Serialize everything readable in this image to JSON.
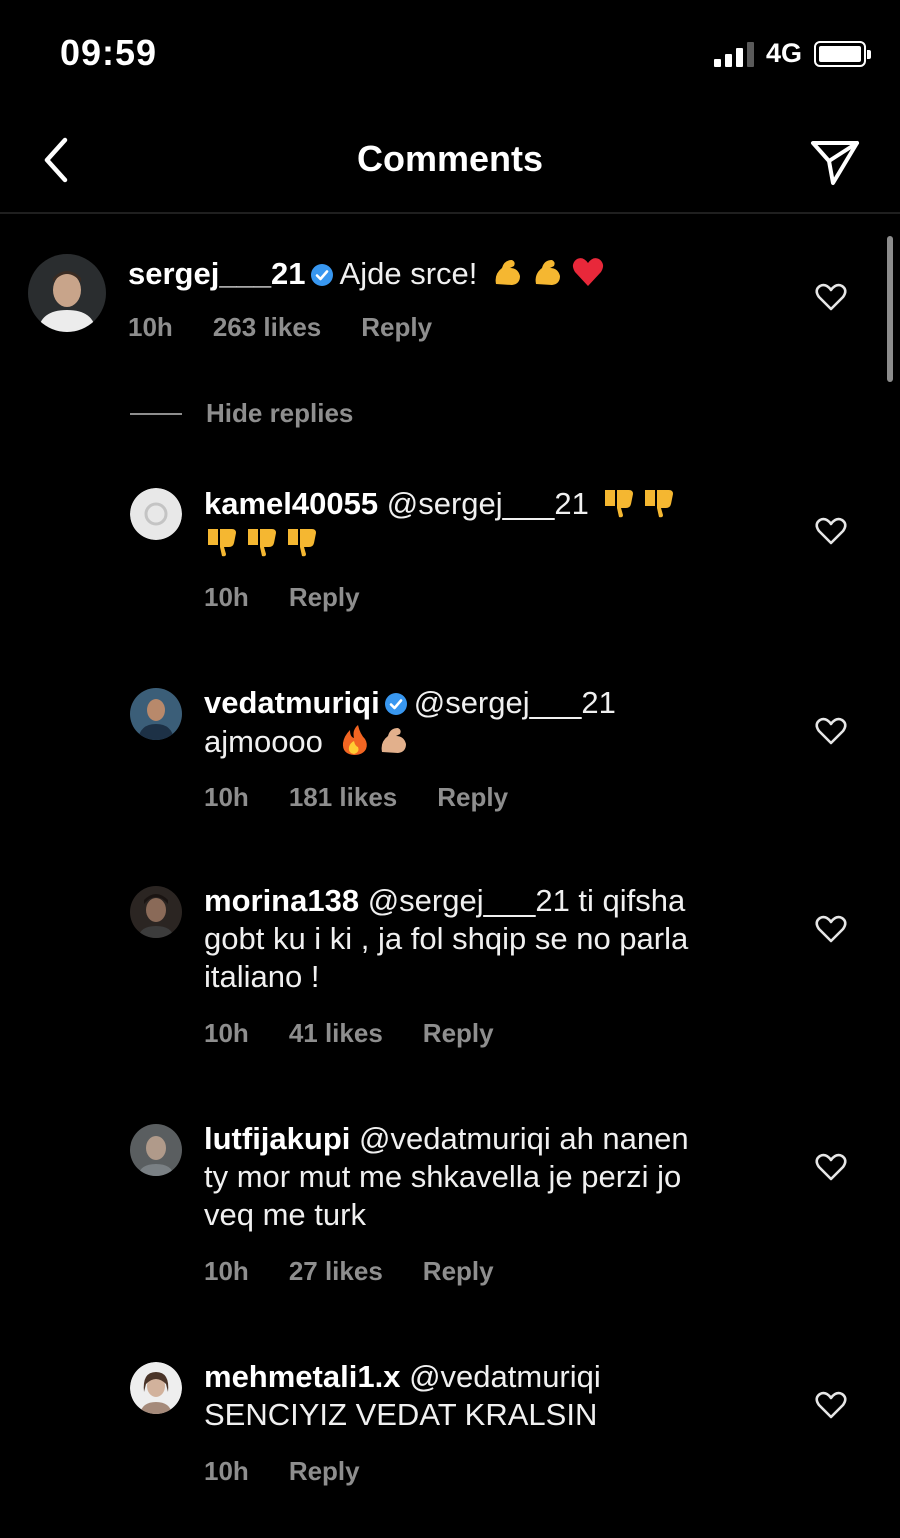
{
  "status_bar": {
    "time": "09:59",
    "network": "4G"
  },
  "header": {
    "title": "Comments",
    "back_icon": "chevron-left-icon",
    "send_icon": "paper-plane-icon"
  },
  "hide_replies": "Hide replies",
  "main_comment": {
    "username": "sergej___21",
    "verified": true,
    "text": "Ajde srce!",
    "emojis": [
      "flexed-biceps",
      "flexed-biceps",
      "red-heart"
    ],
    "time": "10h",
    "likes": "263 likes",
    "reply": "Reply"
  },
  "replies": [
    {
      "username": "kamel40055",
      "verified": false,
      "text_line1": "@sergej___21",
      "emojis": [
        "thumbs-down",
        "thumbs-down",
        "thumbs-down",
        "thumbs-down",
        "thumbs-down"
      ],
      "time": "10h",
      "likes": "",
      "reply": "Reply"
    },
    {
      "username": "vedatmuriqi",
      "verified": true,
      "mention": "@sergej___21",
      "text_line2": "ajmoooo",
      "emojis": [
        "fire",
        "flexed-biceps"
      ],
      "time": "10h",
      "likes": "181 likes",
      "reply": "Reply"
    },
    {
      "username": "morina138",
      "verified": false,
      "text_line1": "@sergej___21  ti qifsha",
      "text_line2": "gobt ku i ki , ja fol shqip se no parla",
      "text_line3": "italiano !",
      "time": "10h",
      "likes": "41 likes",
      "reply": "Reply"
    },
    {
      "username": "lutfijakupi",
      "verified": false,
      "text_line1": "@vedatmuriqi ah nanen",
      "text_line2": "ty mor mut me shkavella je perzi jo",
      "text_line3": "veq me turk",
      "time": "10h",
      "likes": "27 likes",
      "reply": "Reply"
    },
    {
      "username": "mehmetali1.x",
      "verified": false,
      "text_line1": "@vedatmuriqi",
      "text_line2": "SENCIYIZ VEDAT KRALSIN",
      "time": "10h",
      "likes": "",
      "reply": "Reply"
    }
  ]
}
